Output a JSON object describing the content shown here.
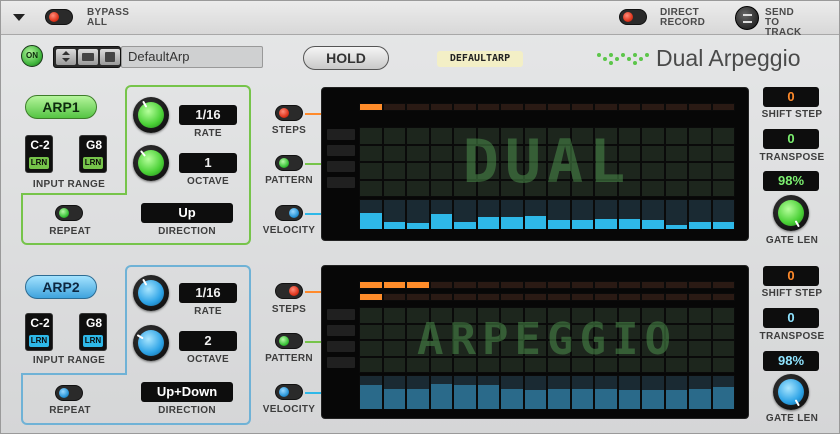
{
  "topbar": {
    "menu_icon": "triangle-down-icon",
    "bypass_label": "BYPASS ALL",
    "direct_record_label": "DIRECT RECORD",
    "send_to_track_label": "SEND TO TRACK",
    "send_icon": "send-to-track-icon"
  },
  "header": {
    "on_label": "ON",
    "patch_name": "DefaultArp",
    "hold_label": "HOLD",
    "tag_label": "DEFAULTARP",
    "product_name": "Dual Arpeggio",
    "logo_icon": "dot-wave-logo-icon"
  },
  "arp1": {
    "title": "ARP1",
    "range_low": "C-2",
    "range_high": "G8",
    "lrn": "LRN",
    "input_range_label": "INPUT RANGE",
    "rate": "1/16",
    "rate_label": "RATE",
    "octave": "1",
    "octave_label": "OCTAVE",
    "repeat_label": "REPEAT",
    "direction": "Up",
    "direction_label": "DIRECTION",
    "steps_label": "STEPS",
    "pattern_label": "PATTERN",
    "velocity_label": "VELOCITY",
    "shift_step": "0",
    "shift_step_label": "SHIFT STEP",
    "transpose": "0",
    "transpose_label": "TRANSPOSE",
    "gate_len": "98%",
    "gate_len_label": "GATE LEN",
    "accent": "#76c44a"
  },
  "arp2": {
    "title": "ARP2",
    "range_low": "C-2",
    "range_high": "G8",
    "lrn": "LRN",
    "input_range_label": "INPUT RANGE",
    "rate": "1/16",
    "rate_label": "RATE",
    "octave": "2",
    "octave_label": "OCTAVE",
    "repeat_label": "REPEAT",
    "direction": "Up+Down",
    "direction_label": "DIRECTION",
    "steps_label": "STEPS",
    "pattern_label": "PATTERN",
    "velocity_label": "VELOCITY",
    "shift_step": "0",
    "shift_step_label": "SHIFT STEP",
    "transpose": "0",
    "transpose_label": "TRANSPOSE",
    "gate_len": "98%",
    "gate_len_label": "GATE LEN",
    "accent": "#6fb2d6"
  },
  "sequencer1": {
    "step_count": 16,
    "active_steps": [
      0
    ],
    "pattern_word": "DUAL",
    "velocities": [
      0.55,
      0.25,
      0.2,
      0.5,
      0.25,
      0.4,
      0.4,
      0.45,
      0.3,
      0.3,
      0.35,
      0.35,
      0.3,
      0.15,
      0.25,
      0.25
    ]
  },
  "sequencer2": {
    "step_count": 16,
    "active_steps": [
      0
    ],
    "range_steps": 3,
    "pattern_word": "ARPEGGIO",
    "velocities": [
      0.7,
      0.6,
      0.6,
      0.75,
      0.7,
      0.7,
      0.6,
      0.55,
      0.6,
      0.6,
      0.6,
      0.55,
      0.55,
      0.55,
      0.6,
      0.65
    ]
  }
}
